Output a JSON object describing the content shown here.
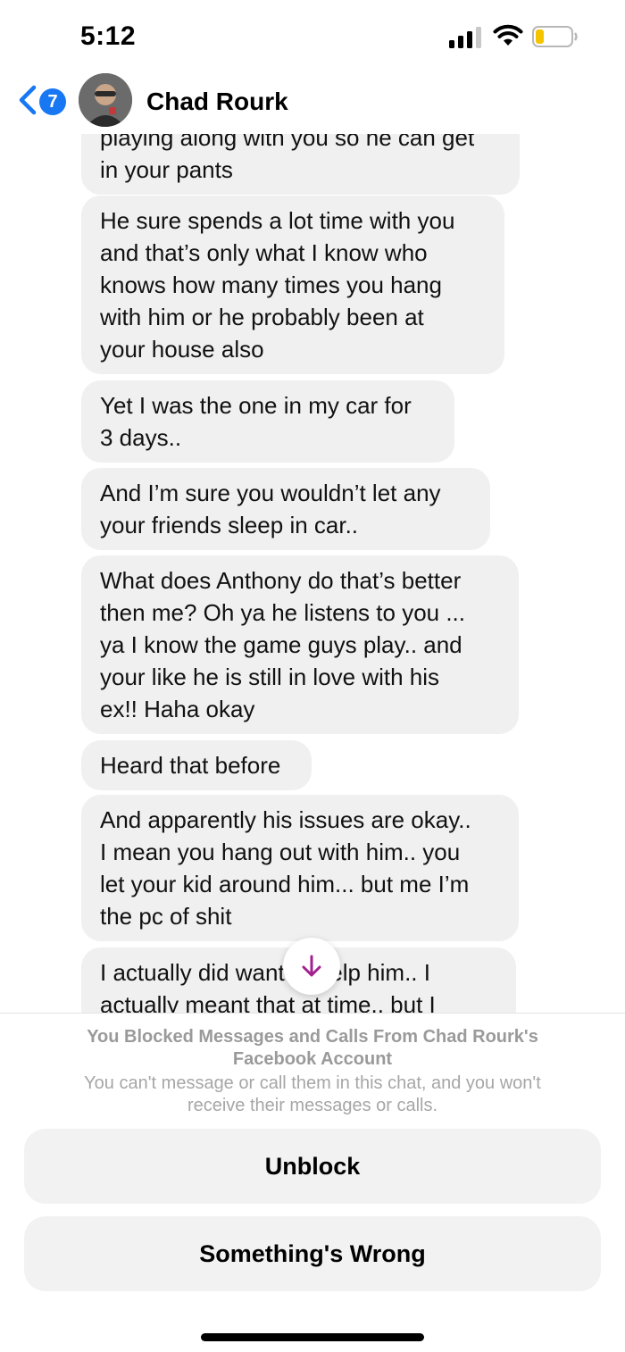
{
  "status_bar": {
    "time": "5:12",
    "battery_color": "#f5c400",
    "signal_icon": "cellular-signal-icon",
    "wifi_icon": "wifi-icon",
    "battery_icon": "battery-icon"
  },
  "header": {
    "back_icon": "chevron-left-icon",
    "unread_count": "7",
    "contact_name": "Chad Rourk",
    "accent_color": "#1877f2"
  },
  "messages": [
    {
      "text": "playing along with you so he can get\nin your pants"
    },
    {
      "text": "He sure spends a lot time with you\nand that’s only what I know who\nknows how many times you hang\nwith him or he probably been at\nyour house also"
    },
    {
      "text": "Yet I was the one in my car for\n3 days.."
    },
    {
      "text": "And I’m sure you wouldn’t let any\nyour friends sleep in car.."
    },
    {
      "text": "What does Anthony do that’s better\nthen me?  Oh ya he listens to you ...\nya I know the game guys play.. and\nyour like he is still in love with his\nex!! Haha okay"
    },
    {
      "text": "Heard that before"
    },
    {
      "text": "And apparently his issues are okay..\nI mean you hang out with him.. you\nlet your kid around him... but me I’m\nthe pc of shit"
    },
    {
      "text": "I actually did want to help him.. I\nactually meant that at time.. but I"
    }
  ],
  "scroll_down": {
    "icon": "arrow-down-icon",
    "color": "#a3208f"
  },
  "blocked": {
    "title": "You Blocked Messages and Calls From Chad Rourk's\nFacebook Account",
    "description": "You can't message or call them in this chat, and you won't\nreceive their messages or calls.",
    "unblock_label": "Unblock",
    "report_label": "Something's Wrong"
  }
}
